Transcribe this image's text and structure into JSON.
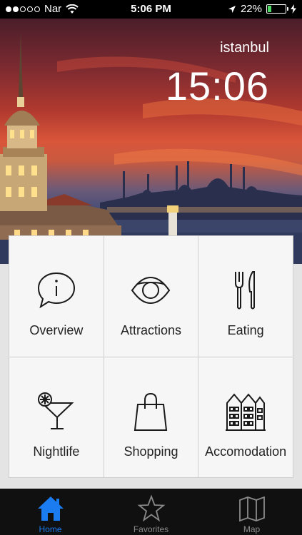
{
  "status_bar": {
    "carrier": "Nar",
    "time": "5:06 PM",
    "battery": "22%",
    "battery_level": 0.22
  },
  "hero": {
    "city": "istanbul",
    "clock": "15:06"
  },
  "menu": {
    "overview": "Overview",
    "attractions": "Attractions",
    "eating": "Eating",
    "nightlife": "Nightlife",
    "shopping": "Shopping",
    "accomodation": "Accomodation"
  },
  "tabs": {
    "home": "Home",
    "favorites": "Favorites",
    "map": "Map"
  },
  "colors": {
    "active_tab": "#1a7cf0",
    "inactive_tab": "#8a8a8a",
    "tile_bg": "#f6f6f6"
  }
}
